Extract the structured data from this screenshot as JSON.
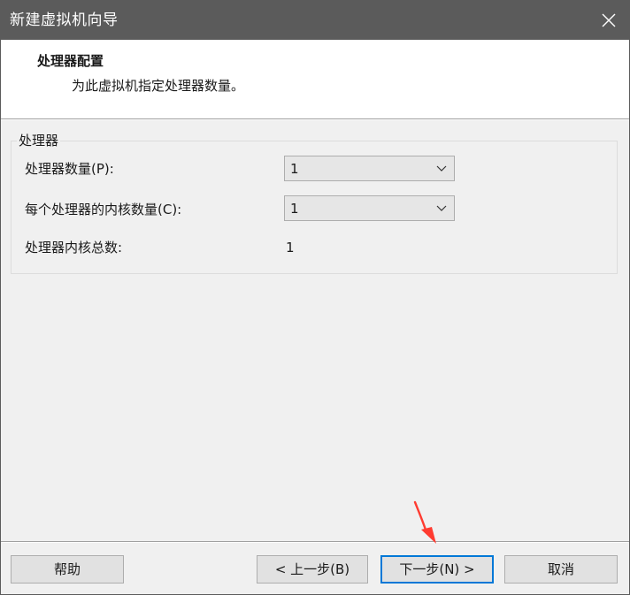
{
  "window": {
    "title": "新建虚拟机向导",
    "close_symbol": "×"
  },
  "header": {
    "title": "处理器配置",
    "subtitle": "为此虚拟机指定处理器数量。"
  },
  "processor_group": {
    "legend": "处理器",
    "processor_count": {
      "label": "处理器数量(P):",
      "value": "1"
    },
    "cores_per_processor": {
      "label": "每个处理器的内核数量(C):",
      "value": "1"
    },
    "total_cores": {
      "label": "处理器内核总数:",
      "value": "1"
    }
  },
  "buttons": {
    "help": "帮助",
    "back": "< 上一步(B)",
    "next": "下一步(N) >",
    "cancel": "取消"
  },
  "colors": {
    "titlebar": "#5b5b5b",
    "focus_border": "#0078d7",
    "annotation_arrow": "#ff3b30"
  },
  "icons": {
    "close": "close-icon",
    "dropdown": "chevron-down-icon",
    "annotation": "red-arrow-icon"
  }
}
